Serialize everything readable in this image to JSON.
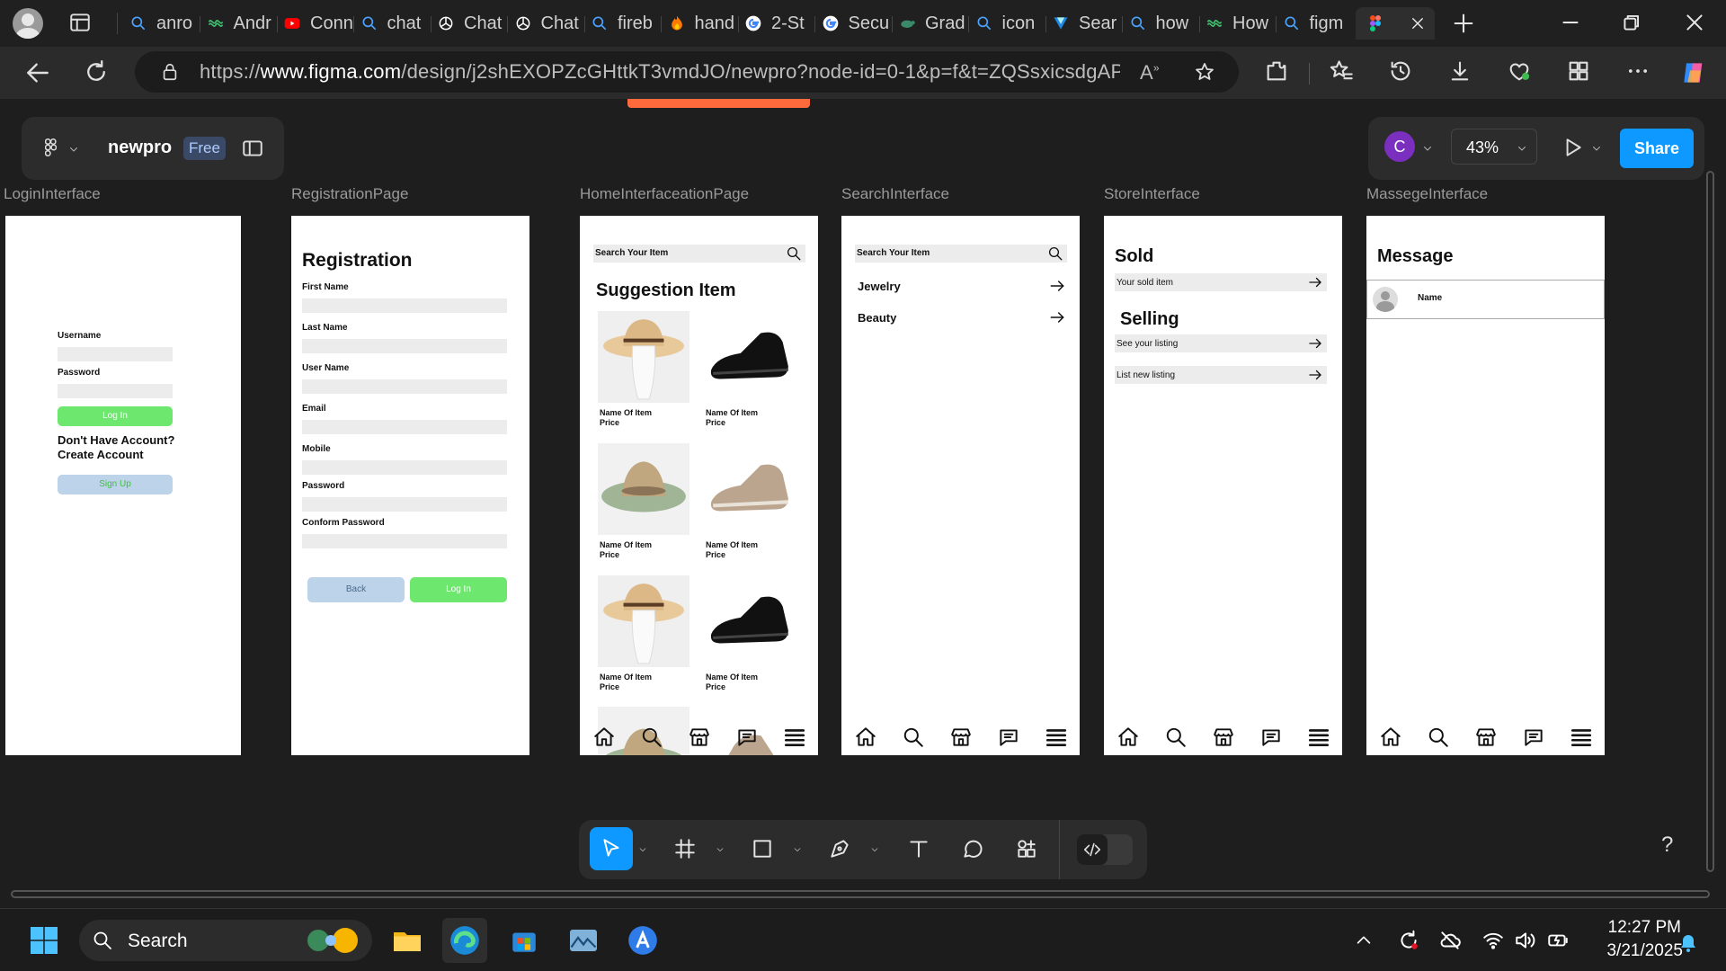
{
  "browser": {
    "tabs": [
      {
        "label": "anro",
        "icon": "search-icon"
      },
      {
        "label": "Andr",
        "icon": "link-icon"
      },
      {
        "label": "Conn",
        "icon": "youtube-icon"
      },
      {
        "label": "chat",
        "icon": "search-icon"
      },
      {
        "label": "Chat",
        "icon": "openai-icon"
      },
      {
        "label": "Chat",
        "icon": "openai-icon"
      },
      {
        "label": "fireb",
        "icon": "search-icon"
      },
      {
        "label": "hand",
        "icon": "flame-icon"
      },
      {
        "label": "2-St",
        "icon": "google-icon"
      },
      {
        "label": "Secu",
        "icon": "google-icon"
      },
      {
        "label": "Grad",
        "icon": "turtle-icon"
      },
      {
        "label": "icon",
        "icon": "search-icon"
      },
      {
        "label": "Sear",
        "icon": "vuetify-icon"
      },
      {
        "label": "how",
        "icon": "search-icon"
      },
      {
        "label": "How",
        "icon": "link-icon"
      },
      {
        "label": "figm",
        "icon": "search-icon"
      }
    ],
    "url_prefix": "https://",
    "url_host": "www.figma.com",
    "url_rest": "/design/j2shEXOPZcGHttkT3vmdJO/newpro?node-id=0-1&p=f&t=ZQSsxicsdgAPC9..."
  },
  "figma": {
    "file_name": "newpro",
    "plan_badge": "Free",
    "avatar_letter": "C",
    "zoom": "43%",
    "share_label": "Share",
    "help": "?"
  },
  "frames": {
    "login": {
      "label": "LoginInterface",
      "username": "Username",
      "password": "Password",
      "login_btn": "Log In",
      "no_account": "Don't Have Account?",
      "create_account": "Create Account",
      "signup_btn": "Sign Up"
    },
    "registration": {
      "label": "RegistrationPage",
      "title": "Registration",
      "fields": [
        "First Name",
        "Last Name",
        "User Name",
        "Email",
        "Mobile",
        "Password",
        "Conform Password"
      ],
      "back_btn": "Back",
      "login_btn": "Log In"
    },
    "home": {
      "label": "HomeInterfaceationPage",
      "search_placeholder": "Search Your Item",
      "title": "Suggestion Item",
      "items": [
        {
          "name": "Name Of Item",
          "price": "Price",
          "kind": "hat-cream"
        },
        {
          "name": "Name Of Item",
          "price": "Price",
          "kind": "shoe-black"
        },
        {
          "name": "Name Of Item",
          "price": "Price",
          "kind": "hat-green"
        },
        {
          "name": "Name Of Item",
          "price": "Price",
          "kind": "shoe-beige"
        },
        {
          "name": "Name Of Item",
          "price": "Price",
          "kind": "hat-cream"
        },
        {
          "name": "Name Of Item",
          "price": "Price",
          "kind": "shoe-black"
        }
      ]
    },
    "search": {
      "label": "SearchInterface",
      "search_placeholder": "Search Your Item",
      "categories": [
        "Jewelry",
        "Beauty"
      ]
    },
    "store": {
      "label": "StoreInterface",
      "sold_title": "Sold",
      "sold_item": "Your sold item",
      "selling_title": "Selling",
      "see_listing": "See your listing",
      "new_listing": "List new listing"
    },
    "message": {
      "label": "MassegeInterface",
      "title": "Message",
      "contact_name": "Name"
    }
  },
  "taskbar": {
    "search_label": "Search",
    "time": "12:27 PM",
    "date": "3/21/2025"
  },
  "colors": {
    "figma_blue": "#0d99ff",
    "login_green": "#6ee76f",
    "signup_blue": "#bcd3ea",
    "avatar_purple": "#7b2fbf",
    "free_badge": "#3a4a66"
  }
}
